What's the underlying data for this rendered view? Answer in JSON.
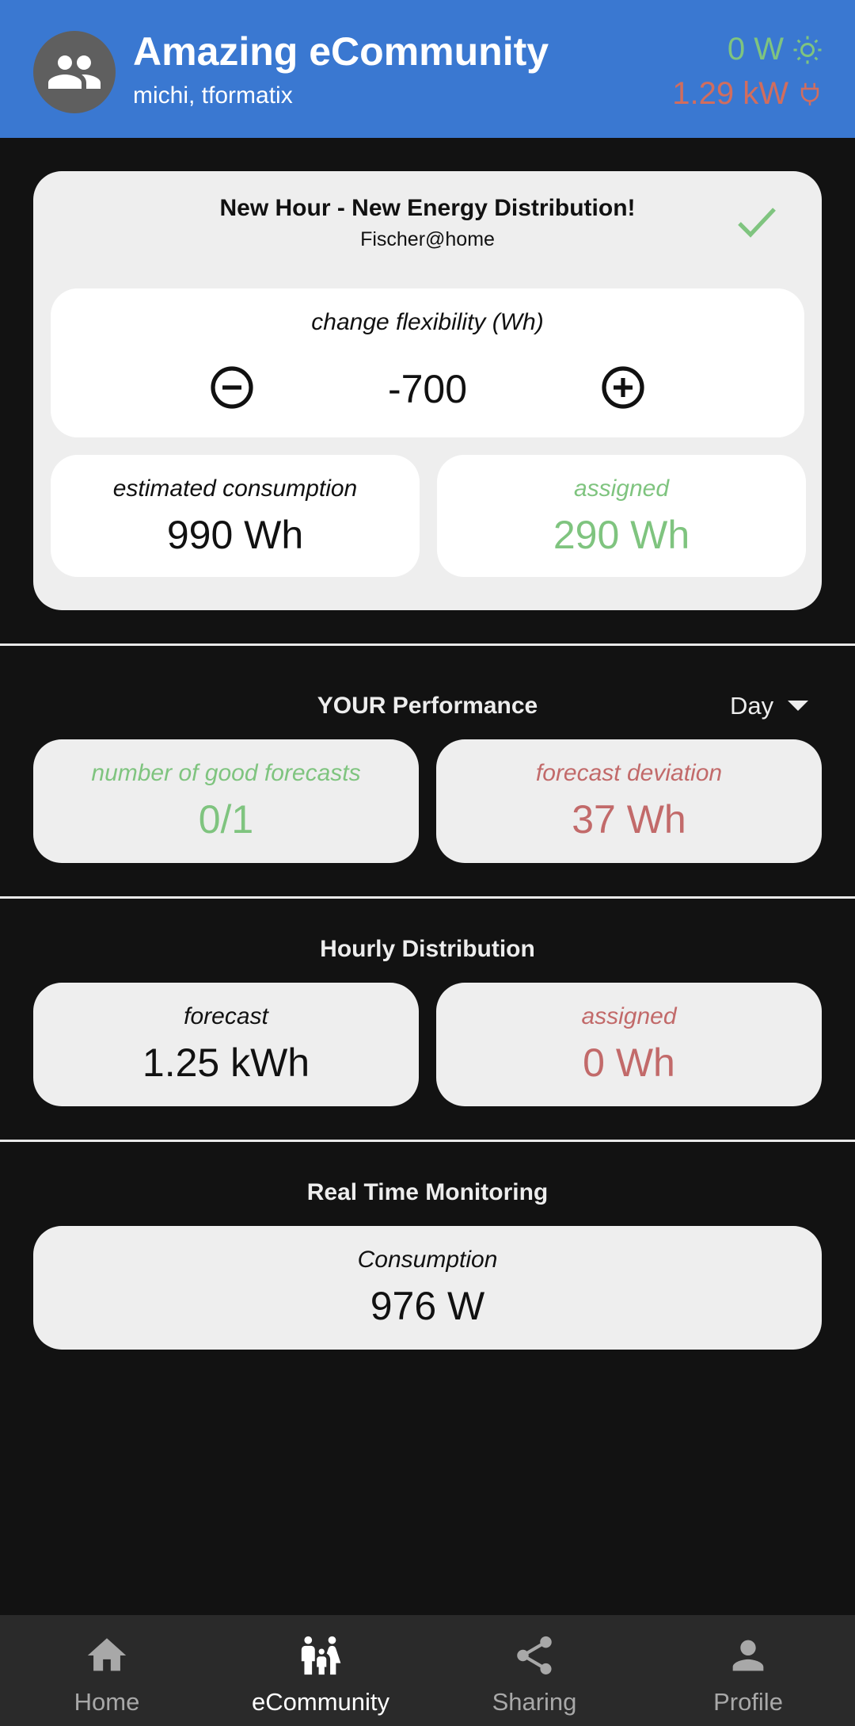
{
  "header": {
    "title": "Amazing eCommunity",
    "subtitle": "michi, tformatix",
    "solar_power": "0 W",
    "grid_power": "1.29 kW",
    "colors": {
      "background": "#3a78d1",
      "solar": "#7fc47f",
      "grid": "#d16d5e"
    },
    "icons": {
      "avatar": "group-icon",
      "solar": "sun-icon",
      "grid": "plug-icon"
    }
  },
  "notification": {
    "title": "New Hour - New Energy Distribution!",
    "subtitle": "Fischer@home",
    "icon": "check-icon",
    "flexibility": {
      "label": "change flexibility (Wh)",
      "value": "-700"
    },
    "estimated_consumption": {
      "label": "estimated consumption",
      "value": "990 Wh"
    },
    "assigned": {
      "label": "assigned",
      "value": "290 Wh"
    }
  },
  "performance": {
    "title": "YOUR Performance",
    "period": "Day",
    "good_forecasts": {
      "label": "number of good forecasts",
      "value": "0/1"
    },
    "forecast_deviation": {
      "label": "forecast deviation",
      "value": "37 Wh"
    }
  },
  "hourly_distribution": {
    "title": "Hourly Distribution",
    "forecast": {
      "label": "forecast",
      "value": "1.25 kWh"
    },
    "assigned": {
      "label": "assigned",
      "value": "0 Wh"
    }
  },
  "real_time": {
    "title": "Real Time Monitoring",
    "consumption": {
      "label": "Consumption",
      "value": "976 W"
    }
  },
  "nav": {
    "items": [
      {
        "label": "Home",
        "icon": "home-icon"
      },
      {
        "label": "eCommunity",
        "icon": "family-icon",
        "active": true
      },
      {
        "label": "Sharing",
        "icon": "share-icon"
      },
      {
        "label": "Profile",
        "icon": "person-icon"
      }
    ]
  }
}
